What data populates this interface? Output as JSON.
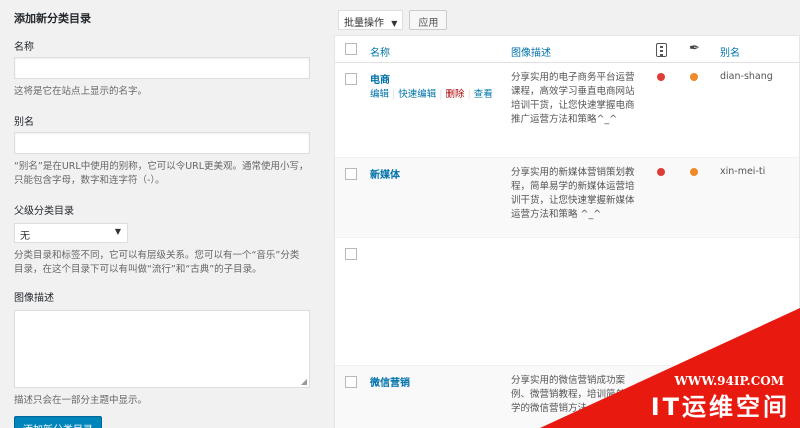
{
  "form": {
    "title": "添加新分类目录",
    "name_label": "名称",
    "name_value": "",
    "name_help": "这将是它在站点上显示的名字。",
    "slug_label": "别名",
    "slug_value": "",
    "slug_help_1": "“别名”是在URL中使用的别称，它可以令URL更美观。通常使用小写，",
    "slug_help_2": "只能包含字母，数字和连字符（-）。",
    "parent_label": "父级分类目录",
    "parent_value": "无",
    "parent_help_1": "分类目录和标签不同，它可以有层级关系。您可以有一个“音乐”分类",
    "parent_help_2": "目录，在这个目录下可以有叫做“流行”和“古典”的子目录。",
    "desc_label": "图像描述",
    "desc_help": "描述只会在一部分主题中显示。",
    "submit_label": "添加新分类目录"
  },
  "toolbar": {
    "bulk_label": "批量操作",
    "apply_label": "应用"
  },
  "table": {
    "headers": {
      "name": "名称",
      "desc": "图像描述",
      "slug": "别名"
    },
    "rows": [
      {
        "name": "电商",
        "actions": [
          "编辑",
          "快速编辑",
          "删除",
          "查看"
        ],
        "desc": "分享实用的电子商务平台运营课程，高效学习垂直电商网站培训干货，让您快速掌握电商推广运营方法和策略^_^",
        "slug": "dian-shang"
      },
      {
        "name": "新媒体",
        "desc": "分享实用的新媒体营销策划教程，简单易学的新媒体运营培训干货，让您快速掌握新媒体运营方法和策略 ^_^",
        "slug": "xin-mei-ti"
      },
      {
        "name": "",
        "desc": "",
        "slug": ""
      },
      {
        "name": "微信营销",
        "desc": "分享实用的微信营销成功案例、微营销教程，培训简单易学的微信营销方法",
        "slug": ""
      }
    ]
  },
  "icons": {
    "dropdown": "chevron-down-icon",
    "column1": "traffic-light-icon",
    "column2": "feather-icon"
  },
  "colors": {
    "link": "#0073aa",
    "primary": "#0085ba",
    "status_red": "#dd3d36",
    "status_orange": "#ee8a2a",
    "watermark": "#e8190f"
  },
  "watermark": {
    "url": "WWW.94IP.COM",
    "title": "IT运维空间"
  }
}
